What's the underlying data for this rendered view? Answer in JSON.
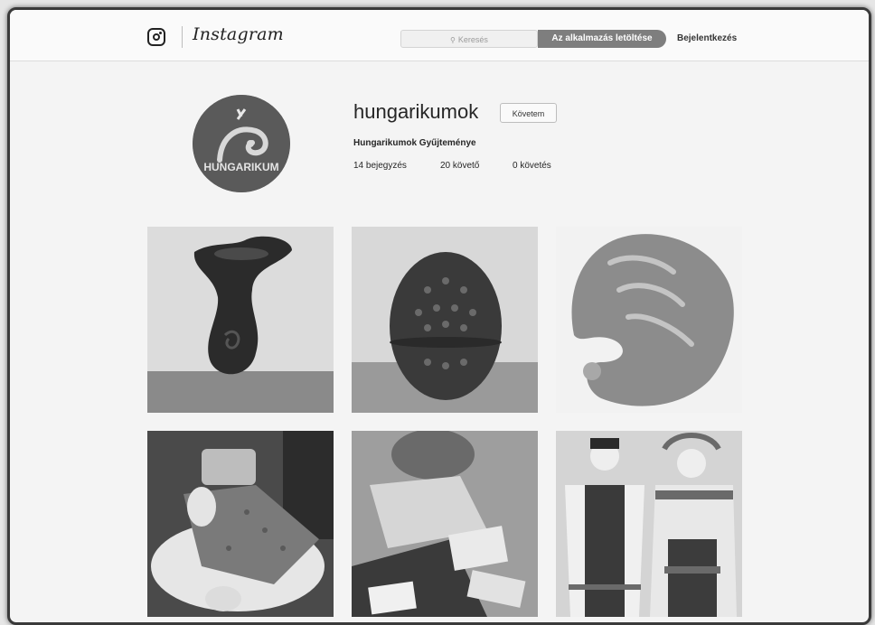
{
  "topbar": {
    "logo_icon": "instagram-camera-icon",
    "wordmark": "Instagram",
    "search_placeholder": "Keresés",
    "search_icon": "search-icon",
    "app_button": "Az alkalmazás letöltése",
    "login": "Bejelentkezés"
  },
  "profile": {
    "avatar_text": "HUNGARIKUM",
    "username": "hungarikumok",
    "follow_button": "Követem",
    "full_name": "Hungarikumok Gyűjteménye",
    "stats": {
      "posts": "14 bejegyzés",
      "followers": "20 követő",
      "following": "0 követés"
    }
  },
  "posts": [
    {
      "subject": "black ceramic vase"
    },
    {
      "subject": "black pierced egg"
    },
    {
      "subject": "porcelain shell dish"
    },
    {
      "subject": "ceramic mugs on plate"
    },
    {
      "subject": "packaged goods and cards"
    },
    {
      "subject": "two folk costume dolls"
    }
  ]
}
